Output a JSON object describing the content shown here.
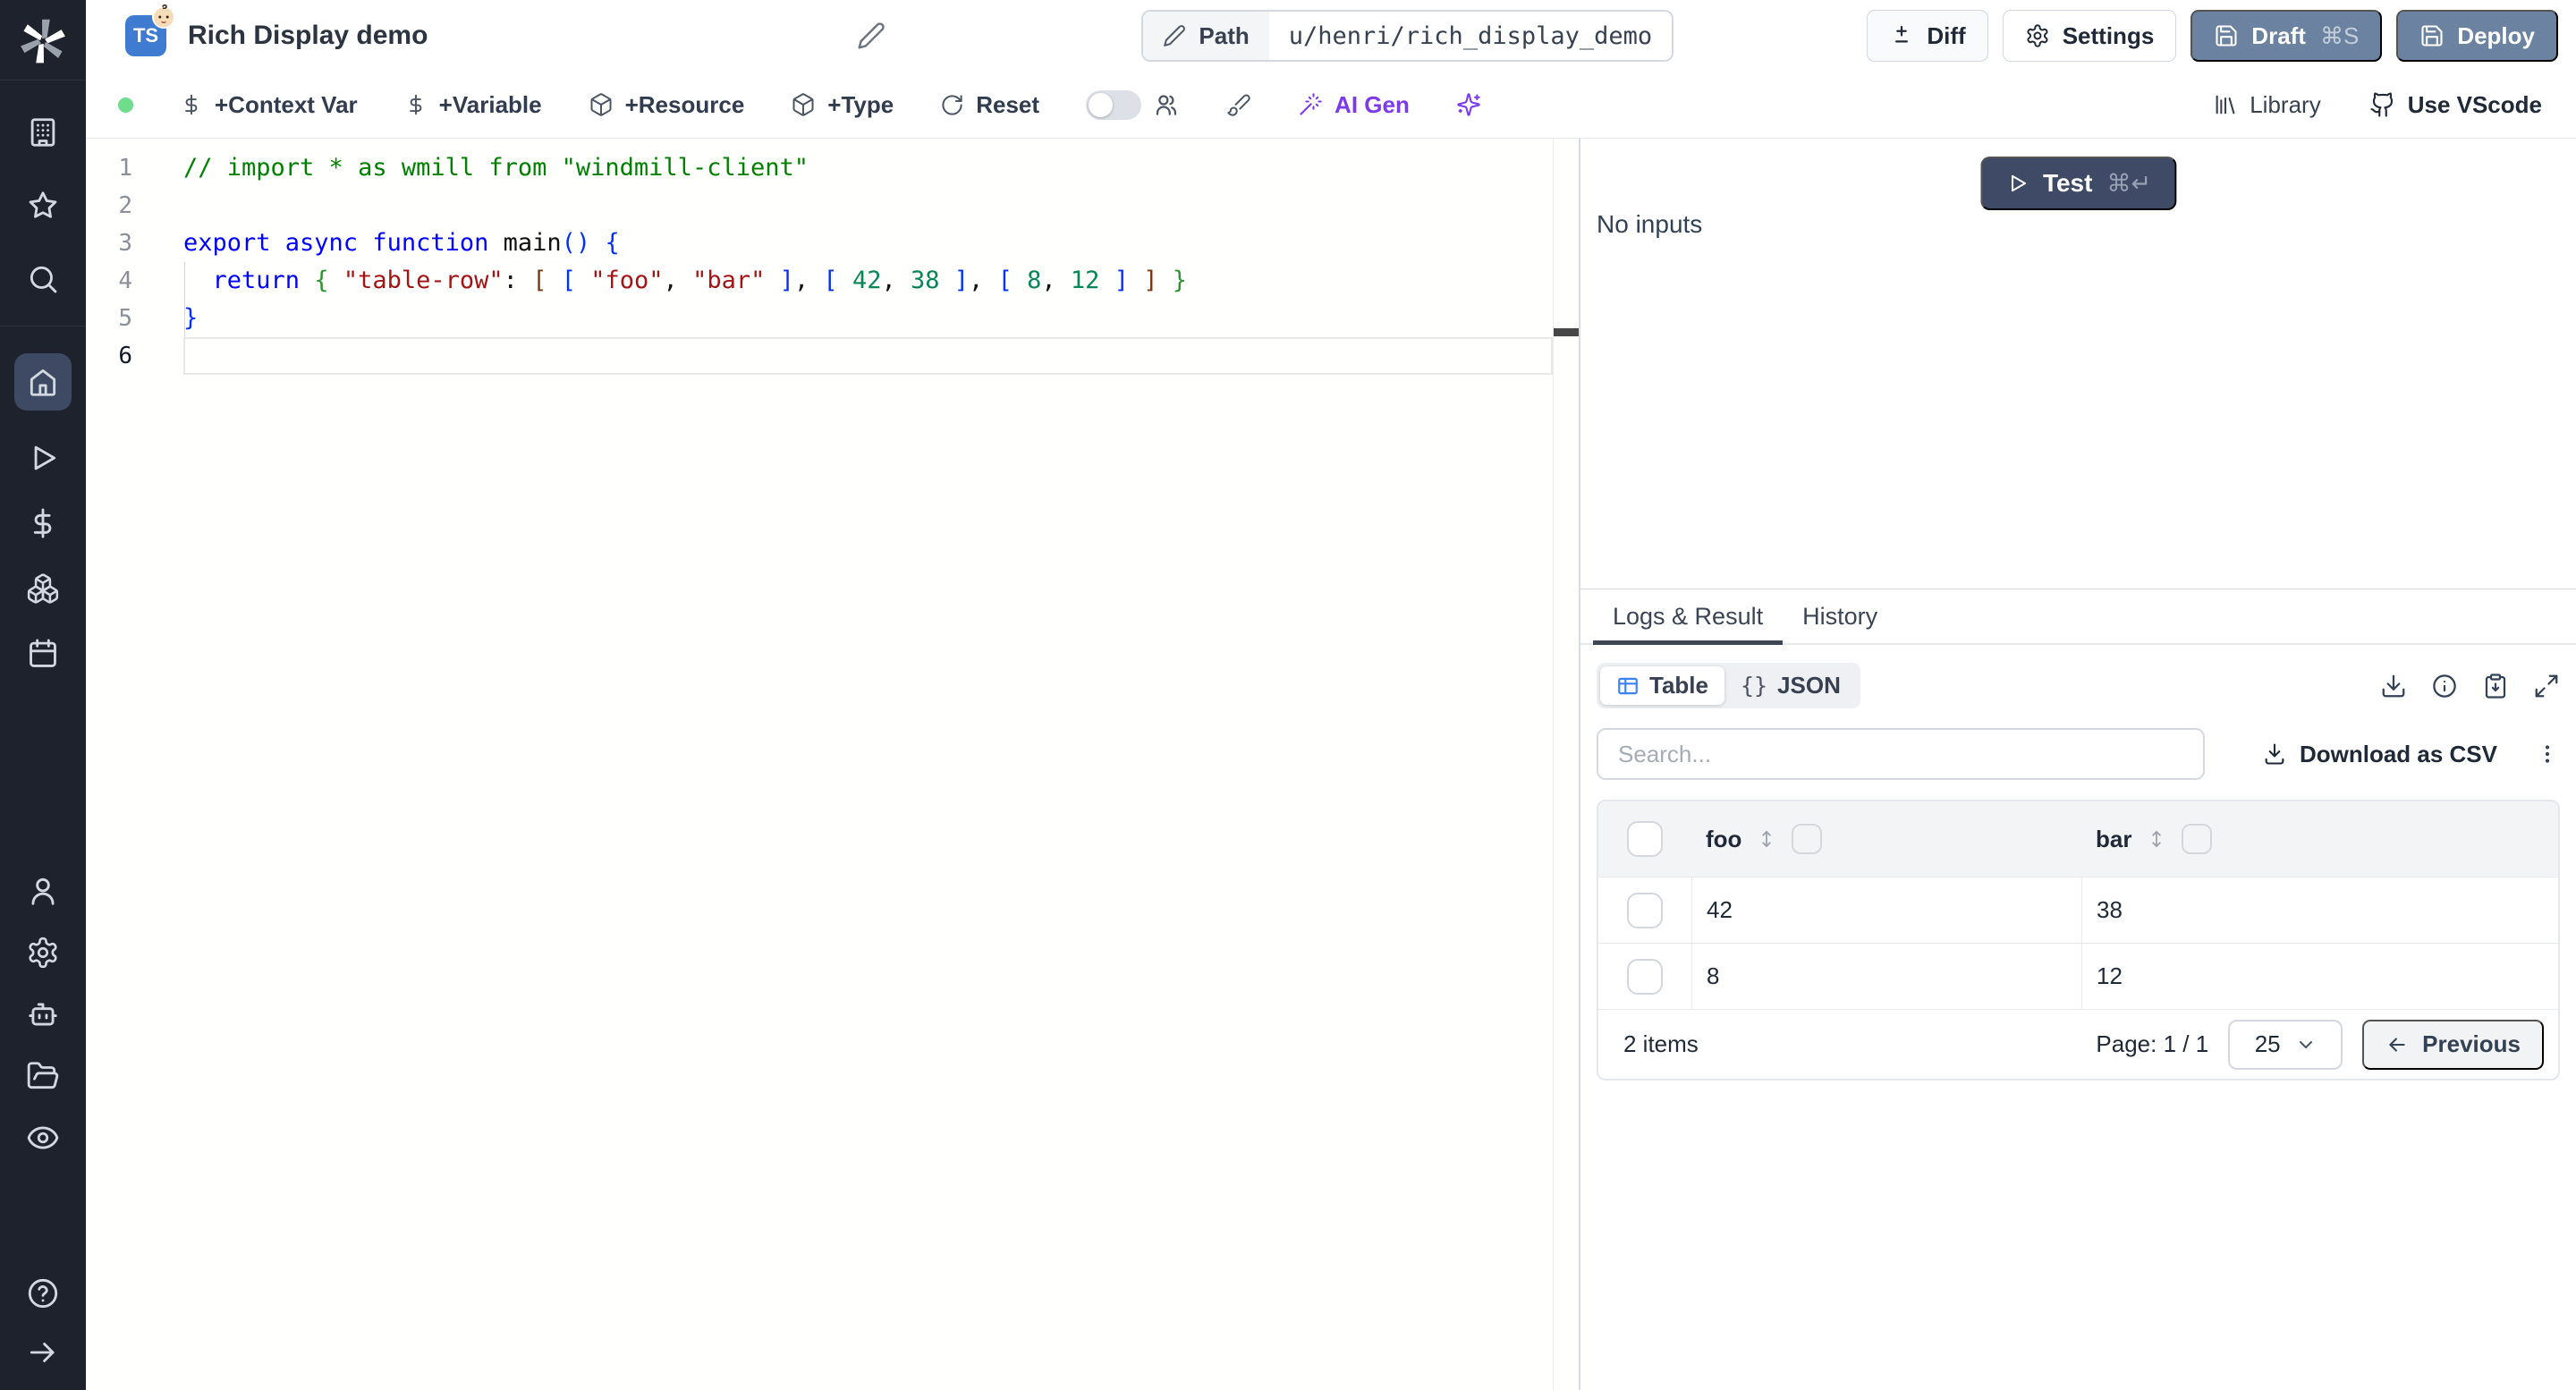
{
  "colors": {
    "sidebar_bg": "#1d222c",
    "active_nav": "#3e4a63",
    "button_slate": "#6b82a1",
    "test_navy": "#3e4a66",
    "ai_purple": "#7c3aed",
    "status_green": "#6fdd8b",
    "table_icon_blue": "#3b82f6"
  },
  "header": {
    "badge": "TS",
    "title": "Rich Display demo",
    "path_label": "Path",
    "path_value": "u/henri/rich_display_demo",
    "diff": "Diff",
    "settings": "Settings",
    "draft": "Draft",
    "draft_shortcut": "⌘S",
    "deploy": "Deploy"
  },
  "toolbar": {
    "context_var": "+Context Var",
    "variable": "+Variable",
    "resource": "+Resource",
    "type": "+Type",
    "reset": "Reset",
    "ai_gen": "AI Gen",
    "library": "Library",
    "vscode": "Use VScode"
  },
  "editor": {
    "lines": [
      {
        "num": "1",
        "tokens": [
          [
            "// import * as wmill from \"windmill-client\"",
            "cm"
          ]
        ]
      },
      {
        "num": "2",
        "tokens": []
      },
      {
        "num": "3",
        "tokens": [
          [
            "export async function ",
            "kw"
          ],
          [
            "main",
            "pl"
          ],
          [
            "()",
            "b1"
          ],
          [
            " ",
            "pl"
          ],
          [
            "{",
            "b1"
          ]
        ]
      },
      {
        "num": "4",
        "tokens": [
          [
            "  ",
            "pl"
          ],
          [
            "return",
            "kw"
          ],
          [
            " ",
            "pl"
          ],
          [
            "{",
            "b2"
          ],
          [
            " ",
            "pl"
          ],
          [
            "\"table-row\"",
            "str"
          ],
          [
            ":",
            "pl"
          ],
          [
            " ",
            "pl"
          ],
          [
            "[",
            "b3"
          ],
          [
            " ",
            "pl"
          ],
          [
            "[",
            "b1"
          ],
          [
            " ",
            "pl"
          ],
          [
            "\"foo\"",
            "str"
          ],
          [
            ",",
            "pl"
          ],
          [
            " ",
            "pl"
          ],
          [
            "\"bar\"",
            "str"
          ],
          [
            " ",
            "pl"
          ],
          [
            "]",
            "b1"
          ],
          [
            ",",
            "pl"
          ],
          [
            " ",
            "pl"
          ],
          [
            "[",
            "b1"
          ],
          [
            " ",
            "pl"
          ],
          [
            "42",
            "num"
          ],
          [
            ",",
            "pl"
          ],
          [
            " ",
            "pl"
          ],
          [
            "38",
            "num"
          ],
          [
            " ",
            "pl"
          ],
          [
            "]",
            "b1"
          ],
          [
            ",",
            "pl"
          ],
          [
            " ",
            "pl"
          ],
          [
            "[",
            "b1"
          ],
          [
            " ",
            "pl"
          ],
          [
            "8",
            "num"
          ],
          [
            ",",
            "pl"
          ],
          [
            " ",
            "pl"
          ],
          [
            "12",
            "num"
          ],
          [
            " ",
            "pl"
          ],
          [
            "]",
            "b1"
          ],
          [
            " ",
            "pl"
          ],
          [
            "]",
            "b3"
          ],
          [
            " ",
            "pl"
          ],
          [
            "}",
            "b2"
          ]
        ]
      },
      {
        "num": "5",
        "tokens": [
          [
            "}",
            "b1"
          ]
        ]
      },
      {
        "num": "6",
        "tokens": [],
        "current": true
      }
    ]
  },
  "run_panel": {
    "test_label": "Test",
    "test_shortcut": "⌘↵",
    "no_inputs": "No inputs"
  },
  "result_panel": {
    "tabs": [
      {
        "label": "Logs & Result"
      },
      {
        "label": "History"
      }
    ],
    "view_toggle": {
      "table": "Table",
      "json": "JSON",
      "json_braces": "{}"
    },
    "search_placeholder": "Search...",
    "download_csv": "Download as CSV",
    "table": {
      "columns": [
        "foo",
        "bar"
      ],
      "rows": [
        [
          "42",
          "38"
        ],
        [
          "8",
          "12"
        ]
      ],
      "footer": {
        "items": "2 items",
        "page": "Page: 1 / 1",
        "page_size": "25",
        "previous": "Previous"
      }
    }
  }
}
